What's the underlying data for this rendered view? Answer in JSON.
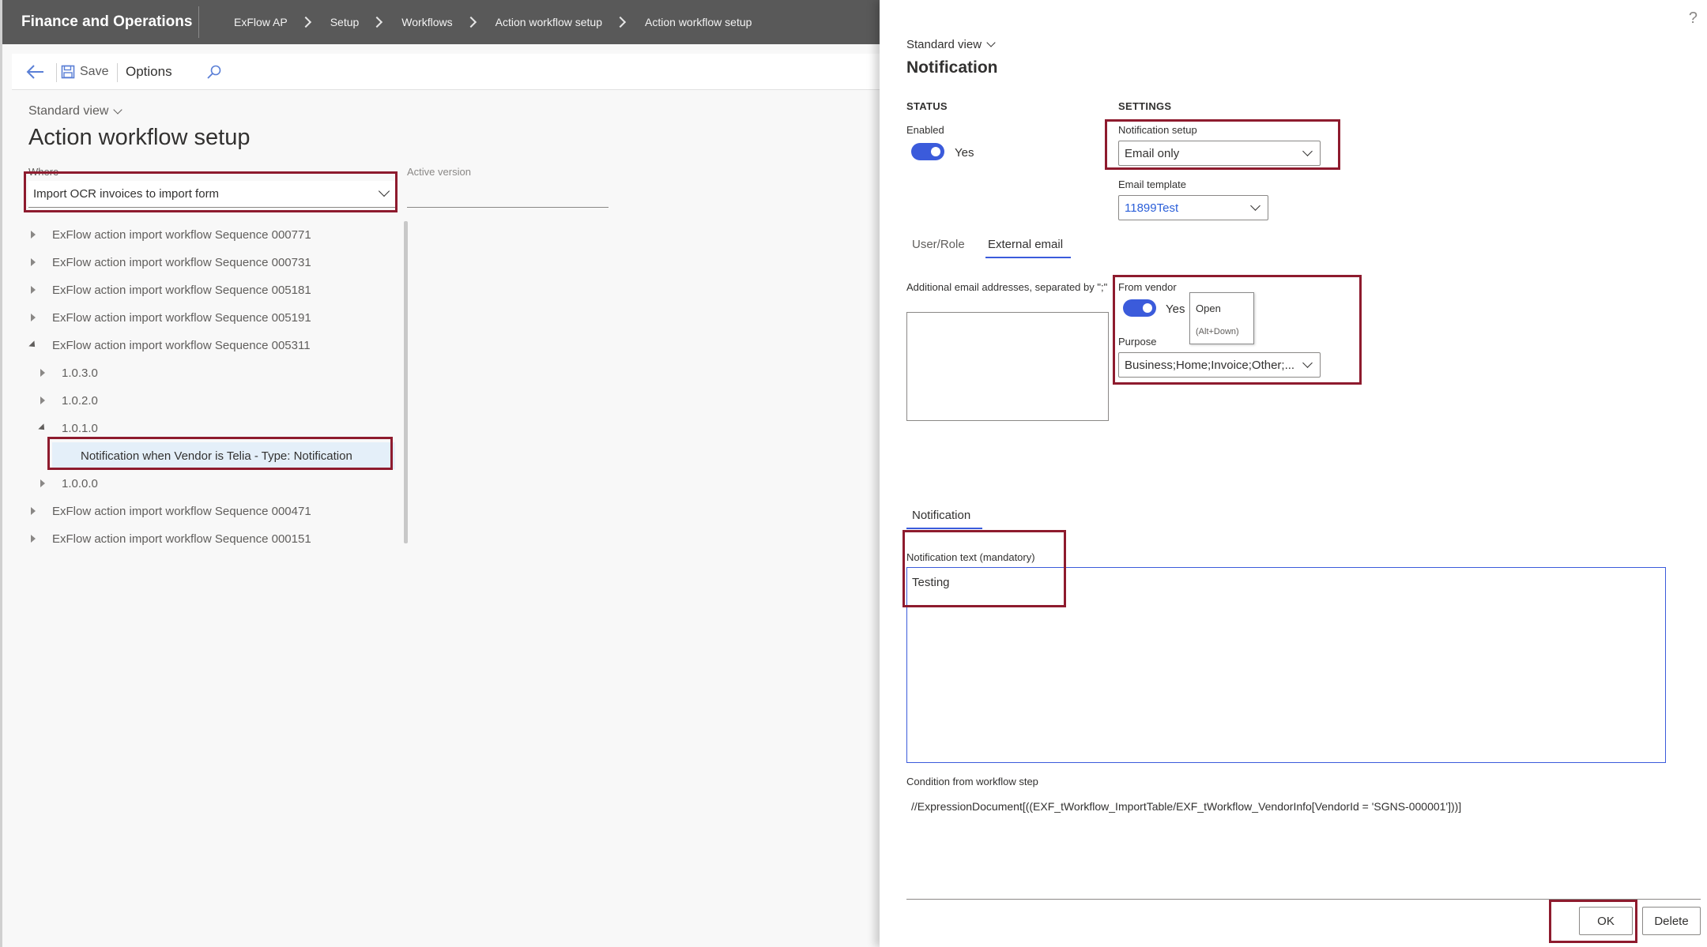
{
  "app": {
    "title": "Finance and Operations"
  },
  "breadcrumb": [
    "ExFlow AP",
    "Setup",
    "Workflows",
    "Action workflow setup",
    "Action workflow setup"
  ],
  "toolbar": {
    "save_label": "Save",
    "options_label": "Options"
  },
  "left": {
    "standard_view": "Standard view",
    "page_title": "Action workflow setup",
    "where_label": "Where",
    "where_value": "Import OCR invoices to import form",
    "active_version_label": "Active version",
    "tree": [
      {
        "label": "ExFlow action import workflow Sequence 000771",
        "level": 0,
        "state": "collapsed"
      },
      {
        "label": "ExFlow action import workflow Sequence 000731",
        "level": 0,
        "state": "collapsed"
      },
      {
        "label": "ExFlow action import workflow Sequence 005181",
        "level": 0,
        "state": "collapsed"
      },
      {
        "label": "ExFlow action import workflow Sequence 005191",
        "level": 0,
        "state": "collapsed"
      },
      {
        "label": "ExFlow action import workflow Sequence 005311",
        "level": 0,
        "state": "expanded"
      },
      {
        "label": "1.0.3.0",
        "level": 1,
        "state": "collapsed"
      },
      {
        "label": "1.0.2.0",
        "level": 1,
        "state": "collapsed"
      },
      {
        "label": "1.0.1.0",
        "level": 1,
        "state": "expanded"
      },
      {
        "label": "Notification when Vendor is Telia - Type: Notification",
        "level": 2,
        "state": "leaf",
        "selected": true
      },
      {
        "label": "1.0.0.0",
        "level": 1,
        "state": "collapsed"
      },
      {
        "label": "ExFlow action import workflow Sequence 000471",
        "level": 0,
        "state": "collapsed"
      },
      {
        "label": "ExFlow action import workflow Sequence 000151",
        "level": 0,
        "state": "collapsed"
      }
    ]
  },
  "right": {
    "help": "?",
    "standard_view": "Standard view",
    "page_title": "Notification",
    "status_heading": "STATUS",
    "settings_heading": "SETTINGS",
    "enabled_label": "Enabled",
    "enabled_value": "Yes",
    "notification_setup_label": "Notification setup",
    "notification_setup_value": "Email only",
    "email_template_label": "Email template",
    "email_template_value": "11899Test",
    "tabs": [
      "User/Role",
      "External email"
    ],
    "active_tab": "External email",
    "addl_email_label": "Additional email addresses, separated by \";\"",
    "from_vendor_label": "From vendor",
    "from_vendor_value": "Yes",
    "tooltip_title": "Open",
    "tooltip_shortcut": "(Alt+Down)",
    "purpose_label": "Purpose",
    "purpose_value": "Business;Home;Invoice;Other;...",
    "notification_tab": "Notification",
    "notification_text_label": "Notification text (mandatory)",
    "notification_text_value": "Testing",
    "condition_label": "Condition from workflow step",
    "condition_value": "//ExpressionDocument[((EXF_tWorkflow_ImportTable/EXF_tWorkflow_VendorInfo[VendorId = 'SGNS-000001']))]",
    "ok_label": "OK",
    "delete_label": "Delete"
  },
  "colors": {
    "accent": "#3b5bdb",
    "annotation": "#8e1b2e",
    "topbar": "#595959"
  }
}
